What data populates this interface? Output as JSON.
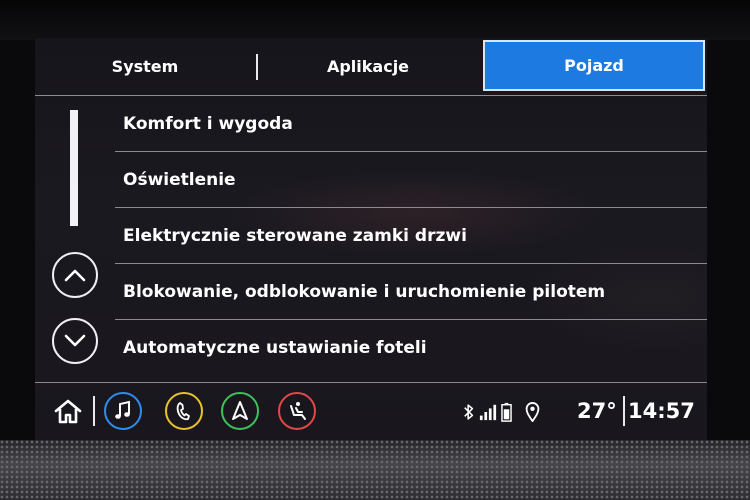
{
  "tabs": [
    {
      "label": "System",
      "active": false
    },
    {
      "label": "Aplikacje",
      "active": false
    },
    {
      "label": "Pojazd",
      "active": true
    }
  ],
  "menu": {
    "items": [
      {
        "label": "Komfort i wygoda"
      },
      {
        "label": "Oświetlenie"
      },
      {
        "label": "Elektrycznie sterowane zamki drzwi"
      },
      {
        "label": "Blokowanie, odblokowanie i uruchomienie pilotem"
      },
      {
        "label": "Automatyczne ustawianie foteli"
      }
    ],
    "scroll": {
      "position": 0,
      "visible_fraction": 0.4
    }
  },
  "bottom_bar": {
    "icons": [
      "home-icon",
      "music-note-icon",
      "phone-icon",
      "navigation-arrow-icon",
      "seat-icon"
    ],
    "ring_colors": {
      "audio": "#2d8cf0",
      "phone": "#e8c22a",
      "nav": "#3fc05a",
      "seat": "#e34848"
    },
    "status_icons": [
      "bluetooth-icon",
      "signal-bars-icon",
      "battery-icon",
      "location-pin-icon"
    ],
    "temperature": "27°",
    "time": "14:57"
  },
  "colors": {
    "active_tab": "#1c7ae0",
    "text": "#ffffff",
    "background": "#17161c"
  }
}
